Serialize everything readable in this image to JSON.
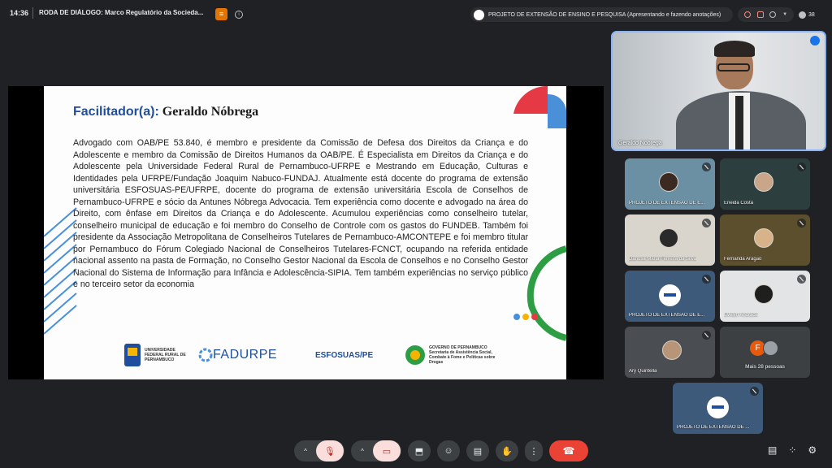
{
  "topbar": {
    "time": "14:36",
    "meeting_title": "RODA DE DIÁLOGO: Marco Regulatório da Socieda...",
    "presenter_chip": "PROJETO DE EXTENSÃO DE ENSINO E PESQUISA (Apresentando e fazendo anotações)",
    "participant_count": "38"
  },
  "slide": {
    "title_label": "Facilitador(a):",
    "title_name": "Geraldo Nóbrega",
    "bio": "Advogado com OAB/PE 53.840, é membro e presidente da Comissão de Defesa dos Direitos da Criança e do Adolescente e membro da Comissão de Direitos Humanos da OAB/PE. É Especialista em Direitos da Criança e do Adolescente pela Universidade Federal Rural de Pernambuco-UFRPE e Mestrando em Educação, Culturas e Identidades pela UFRPE/Fundação Joaquim Nabuco-FUNDAJ. Atualmente está docente do programa de extensão universitária ESFOSUAS-PE/UFRPE, docente do programa de extensão universitária Escola de Conselhos de Pernambuco-UFRPE e sócio da Antunes Nóbrega Advocacia. Tem experiência como docente e advogado na área do Direito, com ênfase em Direitos da Criança e do Adolescente. Acumulou experiências como conselheiro tutelar, conselheiro municipal de educação e foi membro do Conselho de Controle com os gastos do FUNDEB. Também foi presidente da Associação Metropolitana de Conselheiros Tutelares de Pernambuco-AMCONTEPE e foi membro titular por Pernambuco do Fórum Colegiado Nacional de Conselheiros Tutelares-FCNCT, ocupando na referida entidade nacional assento na pasta de Formação, no Conselho Gestor Nacional da Escola de Conselhos e no Conselho Gestor Nacional do Sistema de Informação para Infância e Adolescência-SIPIA. Tem também experiências no serviço público e no terceiro setor da economia",
    "logos": {
      "ufrpe": "UNIVERSIDADE FEDERAL RURAL DE PERNAMBUCO",
      "fadurpe": "FADURPE",
      "esfosuas": "ESFOSUAS/PE",
      "gov_pe": "GOVERNO DE PERNAMBUCO Secretaria de Assistência Social, Combate à Fome e Políticas sobre Drogas"
    },
    "colors": {
      "title_blue": "#1f4e9e",
      "dot_red": "#e63946",
      "dot_yellow": "#f4b400",
      "dot_blue": "#4a90d9"
    }
  },
  "self_view": {
    "name": "Geraldo Nóbrega"
  },
  "participants": [
    {
      "name": "PROJETO DE EXTENSÃO DE E..."
    },
    {
      "name": "Eneida Costa"
    },
    {
      "name": "Danusa Maria Ferreira da Silva"
    },
    {
      "name": "Fernanda Aragão"
    },
    {
      "name": "PROJETO DE EXTENSÃO DE E..."
    },
    {
      "name": "Evelyn Andrade"
    },
    {
      "name": "Ary Quintella"
    },
    {
      "name": "Mais 28 pessoas",
      "initial": "F"
    },
    {
      "name": "PROJETO DE EXTENSÃO DE ..."
    }
  ],
  "controls": {
    "caret": "^",
    "mic_icon": "mic-off-icon",
    "cam_icon": "camera-off-icon",
    "more": "⋮"
  }
}
